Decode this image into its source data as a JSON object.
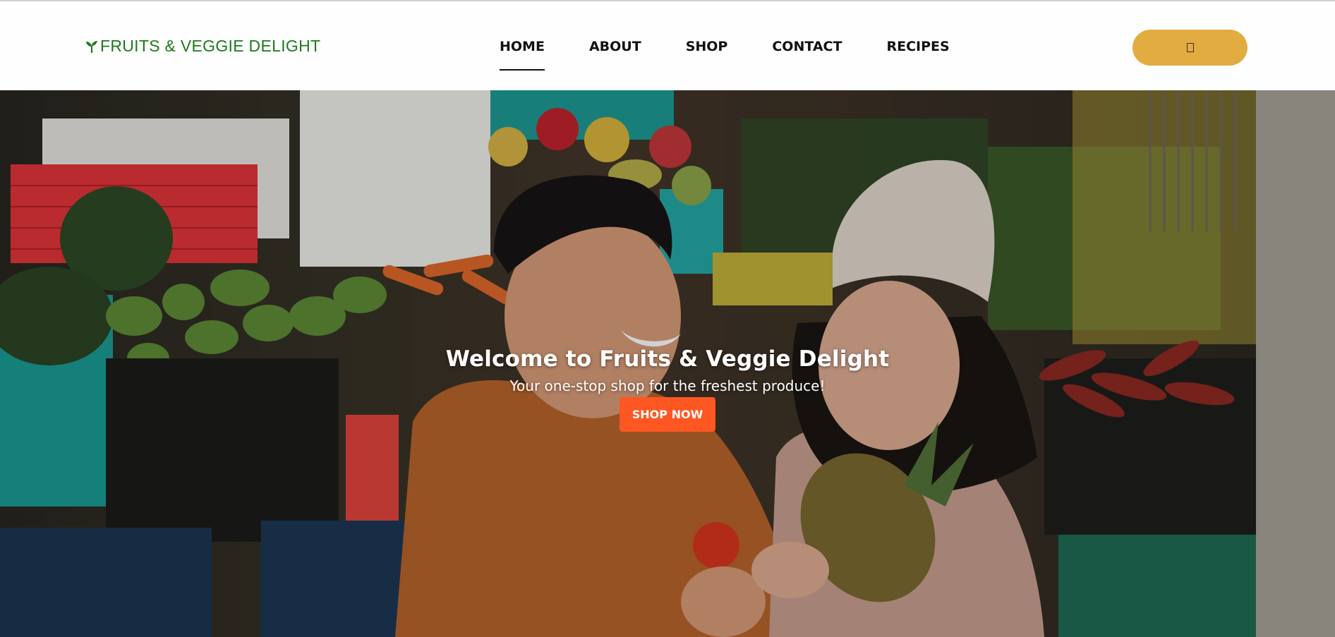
{
  "brand": {
    "name": "FRUITS & VEGGIE DELIGHT",
    "color": "#1d7a1d",
    "icon": "sprout-icon"
  },
  "nav": {
    "items": [
      {
        "label": "HOME",
        "active": true
      },
      {
        "label": "ABOUT",
        "active": false
      },
      {
        "label": "SHOP",
        "active": false
      },
      {
        "label": "CONTACT",
        "active": false
      },
      {
        "label": "RECIPES",
        "active": false
      }
    ]
  },
  "cart": {
    "icon": "cart-icon",
    "color": "#e3ac40"
  },
  "hero": {
    "title": "Welcome to Fruits & Veggie Delight",
    "subtitle": "Your one-stop shop for the freshest produce!",
    "cta_label": "SHOP NOW",
    "cta_color": "#ff5722",
    "background": "market-photo-couple-with-produce"
  }
}
